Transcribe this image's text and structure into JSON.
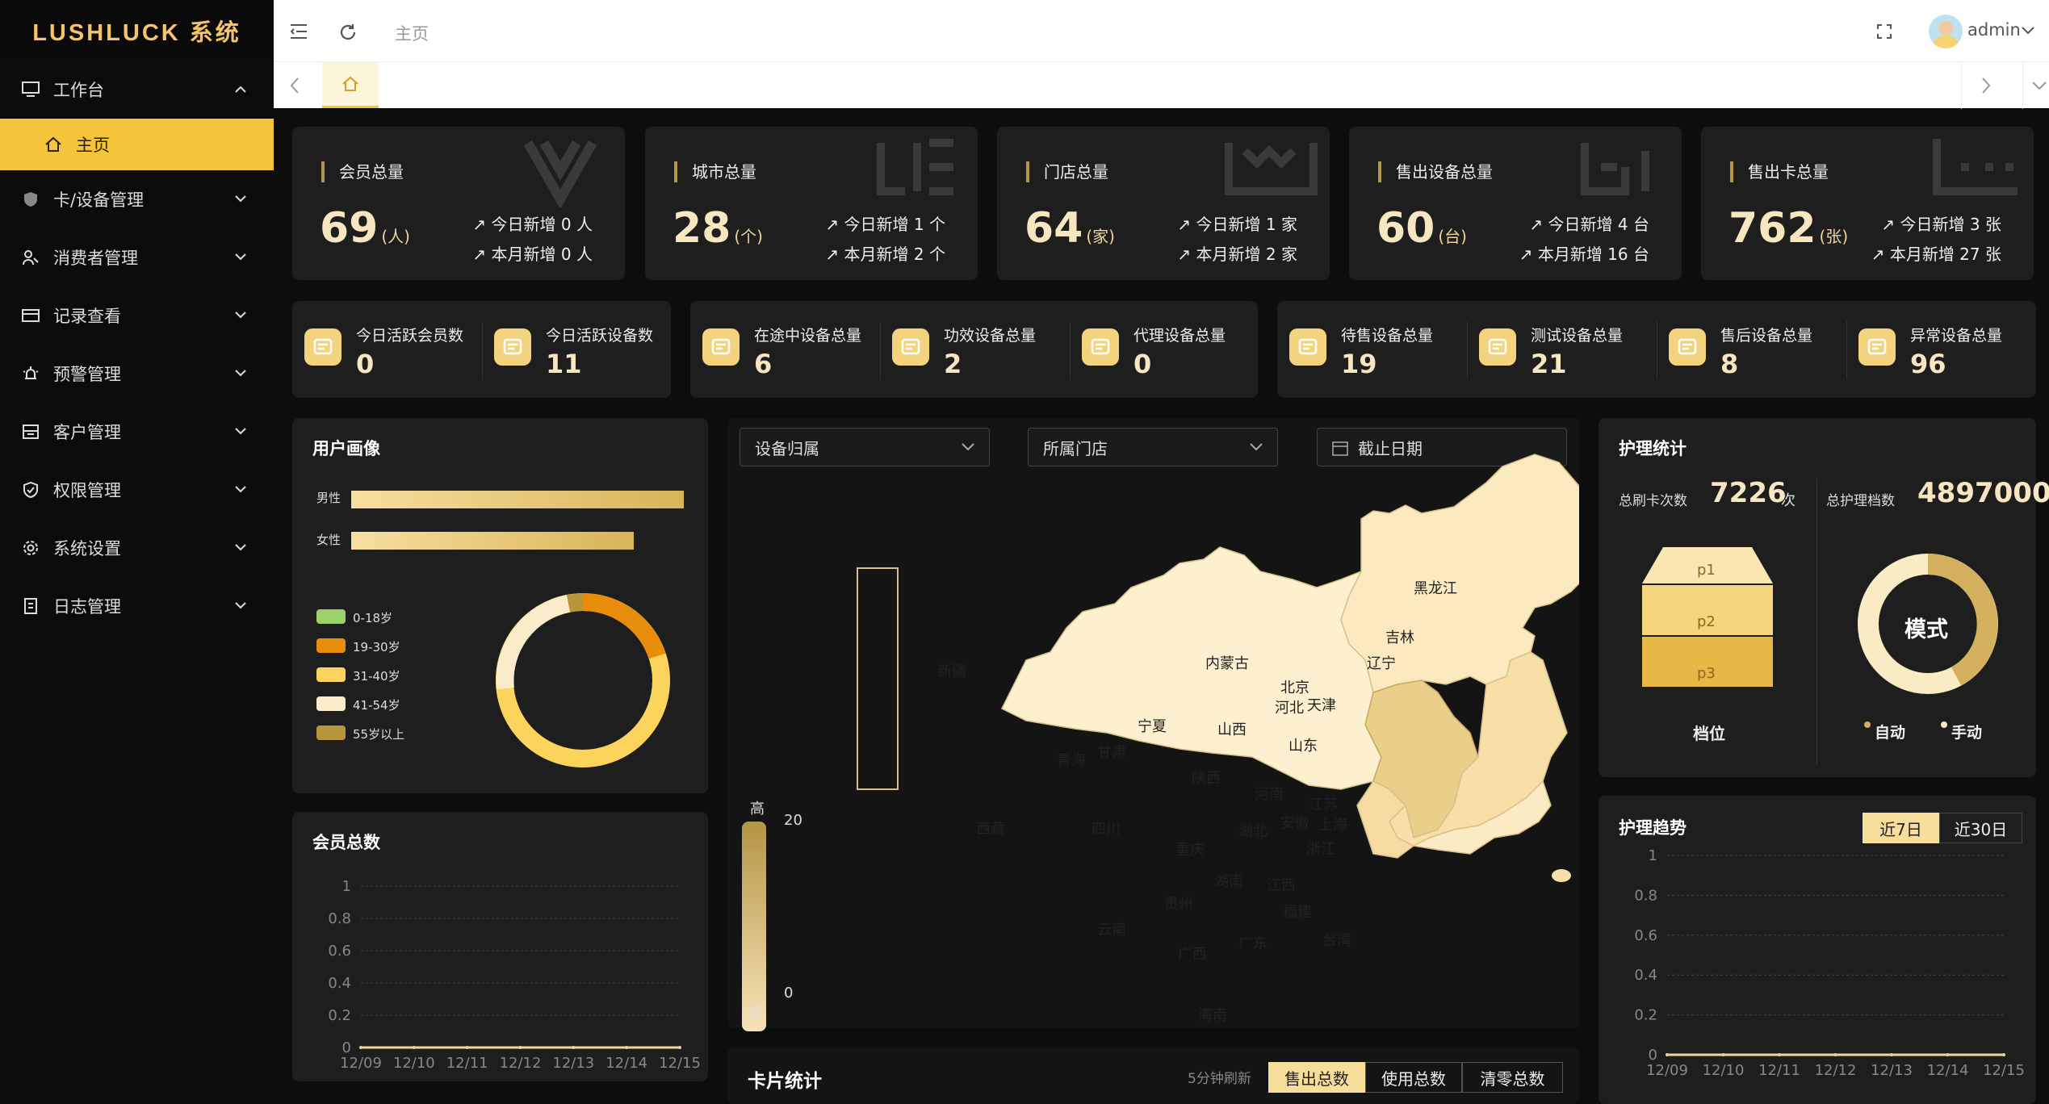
{
  "app": {
    "title": "LUSHLUCK 系统"
  },
  "menu": [
    {
      "label": "工作台",
      "icon": "monitor-icon",
      "expanded": true
    },
    {
      "label": "主页",
      "icon": "home-icon",
      "active": true
    },
    {
      "label": "卡/设备管理",
      "icon": "shield-icon"
    },
    {
      "label": "消费者管理",
      "icon": "users-icon"
    },
    {
      "label": "记录查看",
      "icon": "card-icon"
    },
    {
      "label": "预警管理",
      "icon": "alarm-icon"
    },
    {
      "label": "客户管理",
      "icon": "building-icon"
    },
    {
      "label": "权限管理",
      "icon": "shield-check-icon"
    },
    {
      "label": "系统设置",
      "icon": "gear-icon"
    },
    {
      "label": "日志管理",
      "icon": "doc-icon"
    }
  ],
  "topbar": {
    "breadcrumb": "主页",
    "user": "admin"
  },
  "stats": [
    {
      "label": "会员总量",
      "value": "69",
      "unit": "(人)",
      "today": "今日新增 0 人",
      "month": "本月新增 0 人"
    },
    {
      "label": "城市总量",
      "value": "28",
      "unit": "(个)",
      "today": "今日新增 1 个",
      "month": "本月新增 2 个"
    },
    {
      "label": "门店总量",
      "value": "64",
      "unit": "(家)",
      "today": "今日新增 1 家",
      "month": "本月新增 2 家"
    },
    {
      "label": "售出设备总量",
      "value": "60",
      "unit": "(台)",
      "today": "今日新增 4 台",
      "month": "本月新增 16 台"
    },
    {
      "label": "售出卡总量",
      "value": "762",
      "unit": "(张)",
      "today": "今日新增 3 张",
      "month": "本月新增 27 张"
    }
  ],
  "mini": [
    {
      "label": "今日活跃会员数",
      "value": "0"
    },
    {
      "label": "今日活跃设备数",
      "value": "11"
    },
    {
      "label": "在途中设备总量",
      "value": "6"
    },
    {
      "label": "功效设备总量",
      "value": "2"
    },
    {
      "label": "代理设备总量",
      "value": "0"
    },
    {
      "label": "待售设备总量",
      "value": "19"
    },
    {
      "label": "测试设备总量",
      "value": "21"
    },
    {
      "label": "售后设备总量",
      "value": "8"
    },
    {
      "label": "异常设备总量",
      "value": "96"
    }
  ],
  "portrait": {
    "title": "用户画像",
    "gender": [
      {
        "label": "男性",
        "value": 1.0
      },
      {
        "label": "女性",
        "value": 0.85
      }
    ],
    "ages": [
      {
        "label": "0-18岁",
        "color": "#9ed06b"
      },
      {
        "label": "19-30岁",
        "color": "#e88c0c"
      },
      {
        "label": "31-40岁",
        "color": "#fcd45c"
      },
      {
        "label": "41-54岁",
        "color": "#faeccb"
      },
      {
        "label": "55岁以上",
        "color": "#b7953a"
      }
    ]
  },
  "member": {
    "title": "会员总数"
  },
  "map": {
    "filter1": "设备归属",
    "filter2": "所属门店",
    "filter3": "截止日期",
    "legend_high": "高",
    "legend_low": "低",
    "legend_max": "20",
    "legend_min": "0",
    "labels": [
      "新疆",
      "西藏",
      "青海",
      "甘肃",
      "宁夏",
      "内蒙古",
      "黑龙江",
      "吉林",
      "辽宁",
      "北京",
      "天津",
      "河北",
      "山西",
      "山东",
      "陕西",
      "河南",
      "江苏",
      "四川",
      "重庆",
      "湖北",
      "安徽",
      "上海",
      "浙江",
      "湖南",
      "江西",
      "贵州",
      "云南",
      "福建",
      "广西",
      "广东",
      "台湾",
      "海南"
    ]
  },
  "care": {
    "title": "护理统计",
    "swipe_label": "总刷卡次数",
    "swipe_value": "7226",
    "swipe_unit": "次",
    "gear_label": "总护理档数",
    "gear_value": "4897000",
    "pyramid": [
      "p1",
      "p2",
      "p3"
    ],
    "pyramid_title": "档位",
    "mode_center": "模式",
    "auto": "自动",
    "manual": "手动"
  },
  "trend": {
    "title": "护理趋势",
    "tab7": "近7日",
    "tab30": "近30日"
  },
  "cards": {
    "title": "卡片统计",
    "refresh": "5分钟刷新",
    "btn1": "售出总数",
    "btn2": "使用总数",
    "btn3": "清零总数"
  },
  "chart_data": [
    {
      "type": "line",
      "title": "会员总数",
      "categories": [
        "12/09",
        "12/10",
        "12/11",
        "12/12",
        "12/13",
        "12/14",
        "12/15"
      ],
      "series": [
        {
          "values": [
            0,
            0,
            0,
            0,
            0,
            0,
            0
          ]
        }
      ],
      "ylim": [
        0,
        1
      ],
      "yticks": [
        "0",
        "0.2",
        "0.4",
        "0.6",
        "0.8",
        "1"
      ]
    },
    {
      "type": "line",
      "title": "护理趋势",
      "categories": [
        "12/09",
        "12/10",
        "12/11",
        "12/12",
        "12/13",
        "12/14",
        "12/15"
      ],
      "series": [
        {
          "values": [
            0,
            0,
            0,
            0,
            0,
            0,
            0
          ]
        }
      ],
      "ylim": [
        0,
        1
      ],
      "yticks": [
        "0",
        "0.2",
        "0.4",
        "0.6",
        "0.8",
        "1"
      ]
    }
  ]
}
